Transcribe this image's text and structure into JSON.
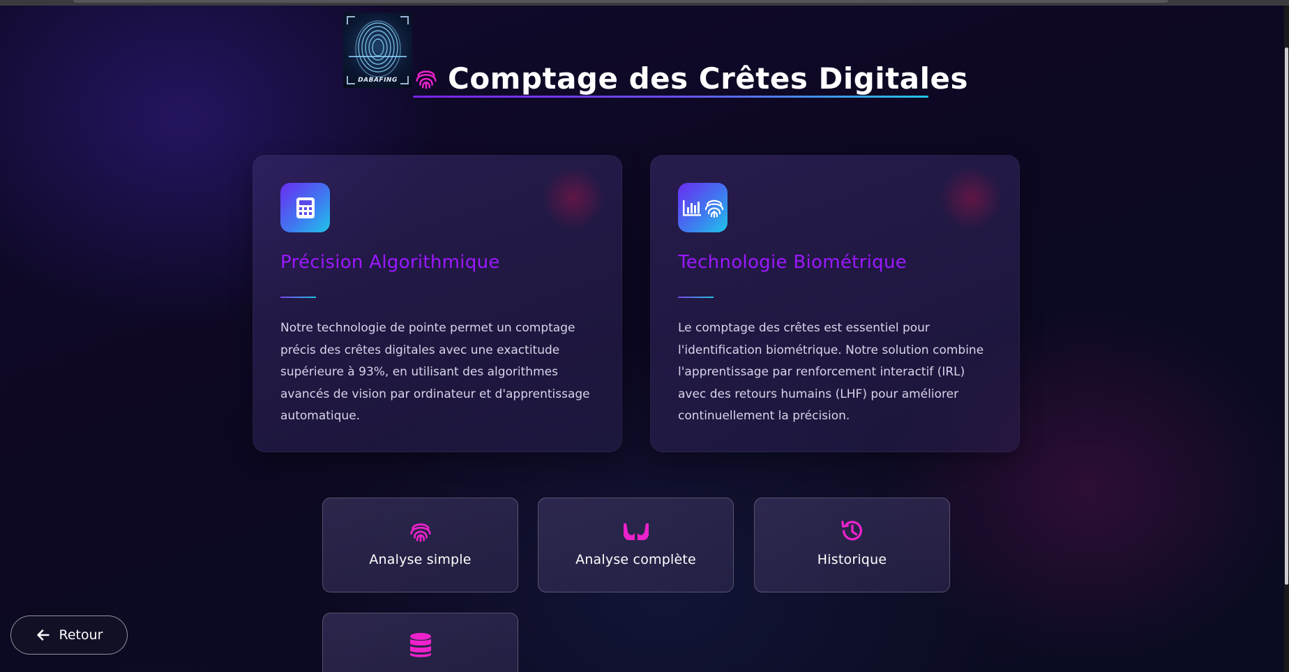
{
  "logo": {
    "text": "DABAFING"
  },
  "header": {
    "title": "Comptage des Crêtes Digitales",
    "icon": "fingerprint-icon"
  },
  "cards": [
    {
      "icon": "calculator-icon",
      "title": "Précision Algorithmique",
      "text": "Notre technologie de pointe permet un comptage précis des crêtes digitales avec une exactitude supérieure à 93%, en utilisant des algorithmes avancés de vision par ordinateur et d'apprentissage automatique."
    },
    {
      "icon": "chart-fingerprint-icon",
      "title": "Technologie Biométrique",
      "text": "Le comptage des crêtes est essentiel pour l'identification biométrique. Notre solution combine l'apprentissage par renforcement interactif (IRL) avec des retours humains (LHF) pour améliorer continuellement la précision."
    }
  ],
  "actions": [
    {
      "label": "Analyse simple",
      "icon": "fingerprint-icon"
    },
    {
      "label": "Analyse complète",
      "icon": "hands-icon"
    },
    {
      "label": "Historique",
      "icon": "history-icon"
    },
    {
      "label": "",
      "icon": "database-icon"
    }
  ],
  "back_button": {
    "label": "Retour",
    "icon": "arrow-left-icon"
  },
  "colors": {
    "accent": "#ee22cc",
    "title_purple": "#9b19ff",
    "gradient_start": "#7a22e6",
    "gradient_end": "#22c6e6"
  }
}
